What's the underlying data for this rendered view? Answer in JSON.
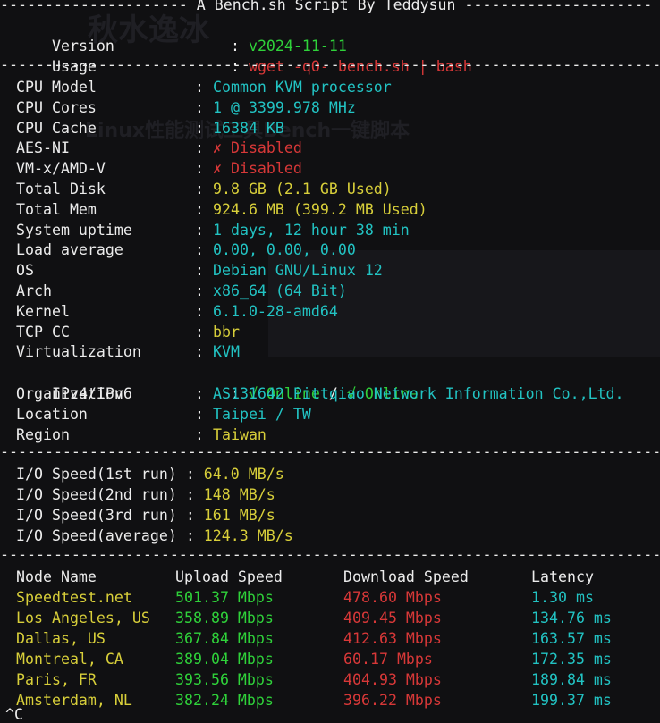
{
  "header": {
    "banner": "--------------------- A Bench.sh Script By Teddysun ---------------------"
  },
  "divider": "--------------------------------------------------------------------------",
  "version": {
    "label": "Version",
    "value": "v2024-11-11"
  },
  "usage": {
    "label": "Usage",
    "value": "wget -qO- bench.sh | bash"
  },
  "sysinfo": [
    {
      "label": "CPU Model",
      "value": "Common KVM processor",
      "color": "cyan"
    },
    {
      "label": "CPU Cores",
      "value": "1 @ 3399.978 MHz",
      "color": "cyan"
    },
    {
      "label": "CPU Cache",
      "value": "16384 KB",
      "color": "cyan"
    },
    {
      "label": "AES-NI",
      "value": "✗ Disabled",
      "color": "red"
    },
    {
      "label": "VM-x/AMD-V",
      "value": "✗ Disabled",
      "color": "red"
    },
    {
      "label": "Total Disk",
      "value": "9.8 GB (2.1 GB Used)",
      "color": "yellow"
    },
    {
      "label": "Total Mem",
      "value": "924.6 MB (399.2 MB Used)",
      "color": "yellow"
    },
    {
      "label": "System uptime",
      "value": "1 days, 12 hour 38 min",
      "color": "cyan"
    },
    {
      "label": "Load average",
      "value": "0.00, 0.00, 0.00",
      "color": "cyan"
    },
    {
      "label": "OS",
      "value": "Debian GNU/Linux 12",
      "color": "cyan"
    },
    {
      "label": "Arch",
      "value": "x86_64 (64 Bit)",
      "color": "cyan"
    },
    {
      "label": "Kernel",
      "value": "6.1.0-28-amd64",
      "color": "cyan"
    },
    {
      "label": "TCP CC",
      "value": "bbr",
      "color": "yellow"
    },
    {
      "label": "Virtualization",
      "value": "KVM",
      "color": "cyan"
    }
  ],
  "ip": {
    "label": "IPv4/IPv6",
    "v4": "√ Online",
    "sep": " / ",
    "v6": "√ Online"
  },
  "location_info": [
    {
      "label": "Organization",
      "value": "AS131642 Pittqiao Network Information Co.,Ltd.",
      "color": "cyan"
    },
    {
      "label": "Location",
      "value": "Taipei / TW",
      "color": "cyan"
    },
    {
      "label": "Region",
      "value": "Taiwan",
      "color": "yellow"
    }
  ],
  "io": [
    {
      "label": "I/O Speed(1st run) : ",
      "value": "64.0 MB/s"
    },
    {
      "label": "I/O Speed(2nd run) : ",
      "value": "148 MB/s"
    },
    {
      "label": "I/O Speed(3rd run) : ",
      "value": "161 MB/s"
    },
    {
      "label": "I/O Speed(average) : ",
      "value": "124.3 MB/s"
    }
  ],
  "speedtest": {
    "headers": [
      "Node Name",
      "Upload Speed",
      "Download Speed",
      "Latency"
    ],
    "rows": [
      [
        "Speedtest.net",
        "501.37 Mbps",
        "478.60 Mbps",
        "1.30 ms"
      ],
      [
        "Los Angeles, US",
        "358.89 Mbps",
        "409.45 Mbps",
        "134.76 ms"
      ],
      [
        "Dallas, US",
        "367.84 Mbps",
        "412.63 Mbps",
        "163.57 ms"
      ],
      [
        "Montreal, CA",
        "389.04 Mbps",
        "60.17 Mbps",
        "172.35 ms"
      ],
      [
        "Paris, FR",
        "393.56 Mbps",
        "404.93 Mbps",
        "189.84 ms"
      ],
      [
        "Amsterdam, NL",
        "382.24 Mbps",
        "396.22 Mbps",
        "199.37 ms"
      ]
    ]
  },
  "prompt": {
    "cursor": "^C"
  }
}
